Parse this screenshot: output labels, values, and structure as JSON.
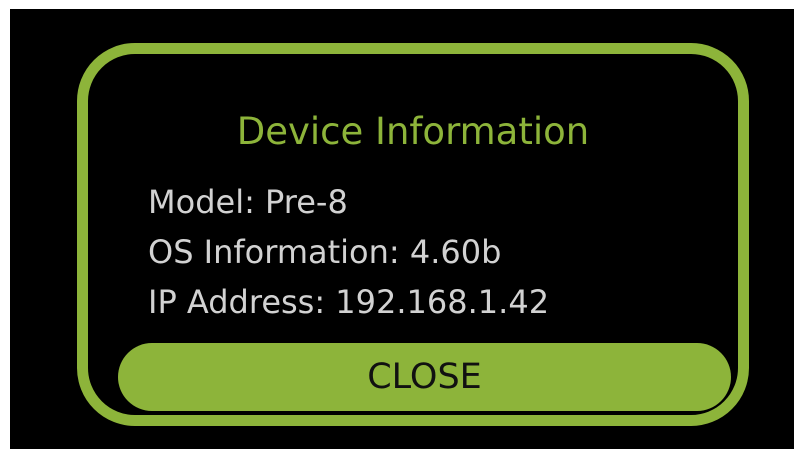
{
  "dialog": {
    "title": "Device Information",
    "accent_color": "#8db43a",
    "info": [
      {
        "label": "Model",
        "value": "Pre-8",
        "text": "Model: Pre-8"
      },
      {
        "label": "OS Information",
        "value": "4.60b",
        "text": "OS Information: 4.60b"
      },
      {
        "label": "IP Address",
        "value": "192.168.1.42",
        "text": "IP Address: 192.168.1.42"
      }
    ],
    "close_label": "CLOSE"
  }
}
